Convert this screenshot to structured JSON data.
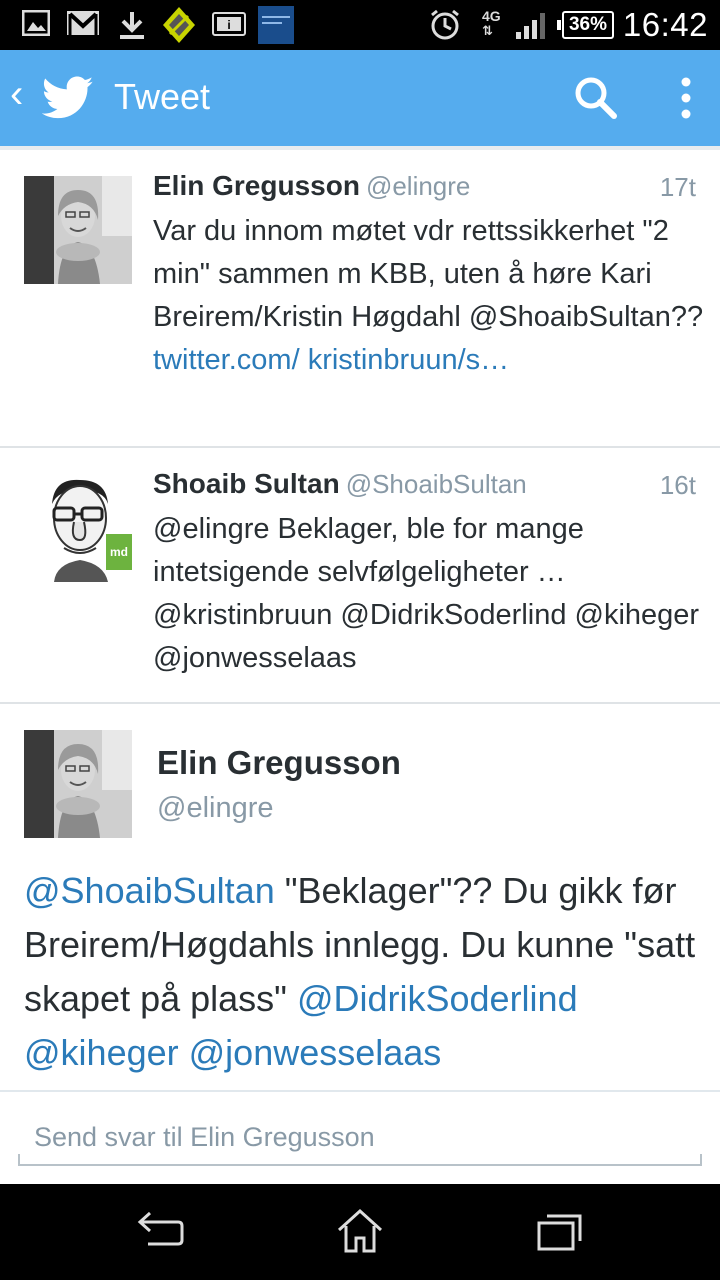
{
  "status_bar": {
    "time": "16:42",
    "battery": "36%",
    "network": "4G",
    "icons": [
      "image-icon",
      "gmail-icon",
      "download-icon",
      "game-icon",
      "info-icon",
      "xperia-lounge-icon",
      "alarm-icon",
      "signal-icon",
      "battery-icon"
    ]
  },
  "action_bar": {
    "title": "Tweet",
    "color": "#55acee"
  },
  "tweets": [
    {
      "name": "Elin Gregusson",
      "handle": "@elingre",
      "time": "17t",
      "text": "Var du innom møtet vdr rettssikkerhet \"2 min\" sammen m KBB, uten å høre Kari Breirem/Kristin Høgdahl @ShoaibSultan?? ",
      "link": "twitter.com/ kristinbruun/s…"
    },
    {
      "name": "Shoaib Sultan",
      "handle": "@ShoaibSultan",
      "time": "16t",
      "text": "@elingre Beklager, ble for mange intetsigende selvfølgeligheter … @kristinbruun @DidrikSoderlind @kiheger @jonwesselaas"
    }
  ],
  "detail": {
    "name": "Elin Gregusson",
    "handle": "@elingre",
    "mention_1": "@ShoaibSultan",
    "text_1": " \"Beklager\"?? Du gikk før Breirem/Høgdahls innlegg. Du kunne \"satt skapet på plass\" ",
    "mention_2": "@DidrikSoderlind",
    "mention_3": "@kiheger",
    "mention_4": "@jonwesselaas"
  },
  "reply": {
    "placeholder": "Send svar til Elin Gregusson"
  }
}
